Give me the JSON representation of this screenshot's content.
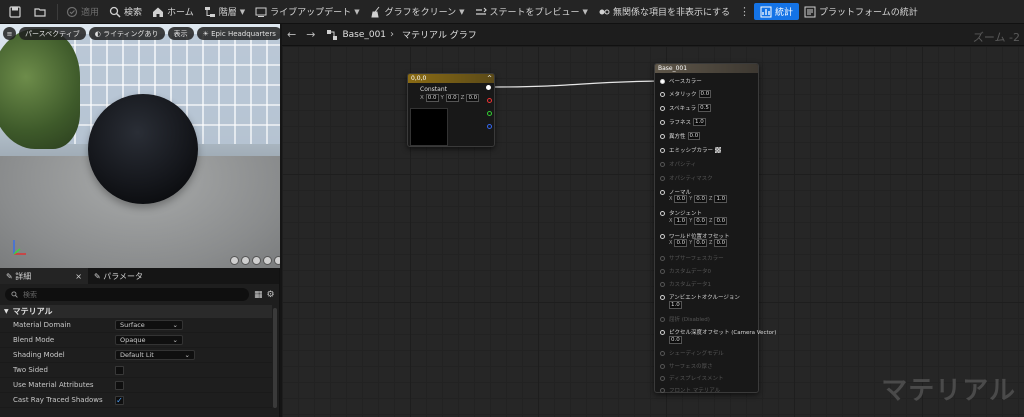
{
  "toolbar": {
    "apply": "適用",
    "search": "検索",
    "home": "ホーム",
    "hierarchy": "階層",
    "live_update": "ライブアップデート",
    "clean_graph": "グラフをクリーン",
    "preview_state": "ステートをプレビュー",
    "hide_unrelated": "無関係な項目を非表示にする",
    "stats": "統計",
    "platform_stats": "プラットフォームの統計"
  },
  "viewport": {
    "perspective": "パースペクティブ",
    "lighting": "ライティングあり",
    "show": "表示",
    "env": "Epic Headquarters"
  },
  "details": {
    "tab_details": "詳細",
    "tab_close": "×",
    "tab_params": "パラメータ",
    "search_placeholder": "検索",
    "section": "マテリアル",
    "rows": [
      {
        "label": "Material Domain",
        "value": "Surface"
      },
      {
        "label": "Blend Mode",
        "value": "Opaque"
      },
      {
        "label": "Shading Model",
        "value": "Default Lit"
      },
      {
        "label": "Two Sided",
        "checked": false
      },
      {
        "label": "Use Material Attributes",
        "checked": false
      },
      {
        "label": "Cast Ray Traced Shadows",
        "checked": true
      }
    ]
  },
  "graph": {
    "crumb_asset": "Base_001",
    "crumb_graph": "マテリアル グラフ",
    "zoom": "ズーム -2",
    "watermark": "マテリアル",
    "const_node": {
      "header": "0,0,0",
      "title": "Constant",
      "x": "0.0",
      "y": "0.0",
      "z": "0.0",
      "labels": {
        "x": "X",
        "y": "Y",
        "z": "Z"
      }
    },
    "mat_node": {
      "header": "Base_001",
      "base_color": "ベースカラー",
      "metallic": "メタリック",
      "metallic_val": "0.0",
      "specular": "スペキュラ",
      "specular_val": "0.5",
      "roughness": "ラフネス",
      "roughness_val": "1.0",
      "anisotropy": "異方性",
      "anisotropy_val": "0.0",
      "emissive": "エミッシブカラー",
      "opacity": "オパシティ",
      "opacity_mask": "オパシティマスク",
      "normal": "ノーマル",
      "normal_x": "0.0",
      "normal_y": "0.0",
      "normal_z": "1.0",
      "tangent": "タンジェント",
      "tangent_x": "1.0",
      "tangent_y": "0.0",
      "tangent_z": "0.0",
      "wpo": "ワールド位置オフセット",
      "wpo_x": "0.0",
      "wpo_y": "0.0",
      "wpo_z": "0.0",
      "subsurface": "サブサーフェスカラー",
      "custom0": "カスタムデータ0",
      "custom1": "カスタムデータ1",
      "ao": "アンビエントオクルージョン",
      "ao_val": "1.0",
      "refraction": "屈折 (Disabled)",
      "pdo": "ピクセル深度オフセット (Camera Vector)",
      "pdo_val": "0.0",
      "shading_model": "シェーディングモデル",
      "surface_thickness": "サーフェスの厚さ",
      "displacement": "ディスプレイスメント",
      "front_material": "フロント マテリアル"
    }
  }
}
